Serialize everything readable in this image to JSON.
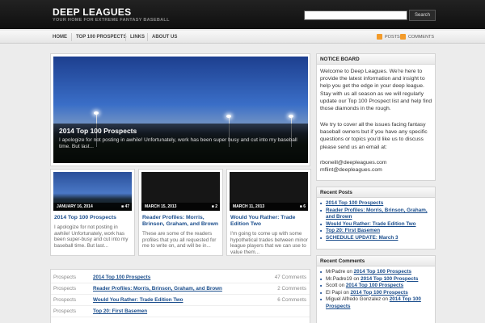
{
  "header": {
    "title": "DEEP LEAGUES",
    "tagline": "YOUR HOME FOR EXTREME FANTASY BASEBALL",
    "search_value": "",
    "search_button": "Search"
  },
  "nav": {
    "items": [
      "HOME",
      "TOP 100 PROSPECTS",
      "LINKS",
      "ABOUT US"
    ],
    "posts_feed": "POSTS",
    "comments_feed": "COMMENTS"
  },
  "featured": {
    "title": "2014 Top 100 Prospects",
    "excerpt": "I apologize for not posting in awhile! Unfortunately, work has been super busy and cut into my baseball time. But last..."
  },
  "cards": [
    {
      "date": "JANUARY 16, 2014",
      "comments": "47",
      "title": "2014 Top 100 Prospects",
      "excerpt": "I apologize for not posting in awhile! Unfortunately, work has been super-busy and cut into my baseball time. But last..."
    },
    {
      "date": "MARCH 15, 2013",
      "comments": "2",
      "title": "Reader Profiles: Morris, Brinson, Graham, and Brown",
      "excerpt": "These are some of the readers profiles that you all requested for me to write on, and will be in..."
    },
    {
      "date": "MARCH 11, 2013",
      "comments": "6",
      "title": "Would You Rather: Trade Edition Two",
      "excerpt": "I'm going to come up with some hypothetical trades between minor league players that we can use to value them..."
    }
  ],
  "posts": [
    {
      "category": "Prospects",
      "title": "2014 Top 100 Prospects",
      "comments": "47 Comments"
    },
    {
      "category": "Prospects",
      "title": "Reader Profiles: Morris, Brinson, Graham, and Brown",
      "comments": "2 Comments"
    },
    {
      "category": "Prospects",
      "title": "Would You Rather: Trade Edition Two",
      "comments": "6 Comments"
    },
    {
      "category": "Prospects",
      "title": "Top 20: First Basemen",
      "comments": ""
    }
  ],
  "notice": {
    "heading": "NOTICE BOARD",
    "para1": "Welcome to Deep Leagues. We're here to provide the latest information and insight to help you get the edge in your deep league. Stay with us all season as we will regularly update our Top 100 Prospect list and help find those diamonds in the rough.",
    "para2": "We try to cover all the issues facing fantasy baseball owners but if you have any specific questions or topics you'd like us to discuss please send us an email at:",
    "email1": "rboneill@deepleagues.com",
    "email2": "mflint@deepleagues.com"
  },
  "recent_posts": {
    "heading": "Recent Posts",
    "items": [
      "2014 Top 100 Prospects",
      "Reader Profiles: Morris, Brinson, Graham, and Brown",
      "Would You Rather: Trade Edition Two",
      "Top 20: First Basemen",
      "SCHEDULE UPDATE: March 3"
    ]
  },
  "recent_comments": {
    "heading": "Recent Comments",
    "items": [
      {
        "author": "MrPadre",
        "on": "on",
        "post": "2014 Top 100 Prospects"
      },
      {
        "author": "Mr.Padre19",
        "on": "on",
        "post": "2014 Top 100 Prospects"
      },
      {
        "author": "Scott",
        "on": "on",
        "post": "2014 Top 100 Prospects"
      },
      {
        "author": "El Papi",
        "on": "on",
        "post": "2014 Top 100 Prospects"
      },
      {
        "author": "Miguel Alfredo Gonzalez",
        "on": "on",
        "post": "2014 Top 100 Prospects"
      }
    ]
  },
  "colors": {
    "link": "#1a4d8c",
    "header_bg": "#151515",
    "feed_icon": "#f39b2a"
  },
  "icons": {
    "feed": "rss-icon",
    "comment_count": "comment-bubble-icon"
  }
}
